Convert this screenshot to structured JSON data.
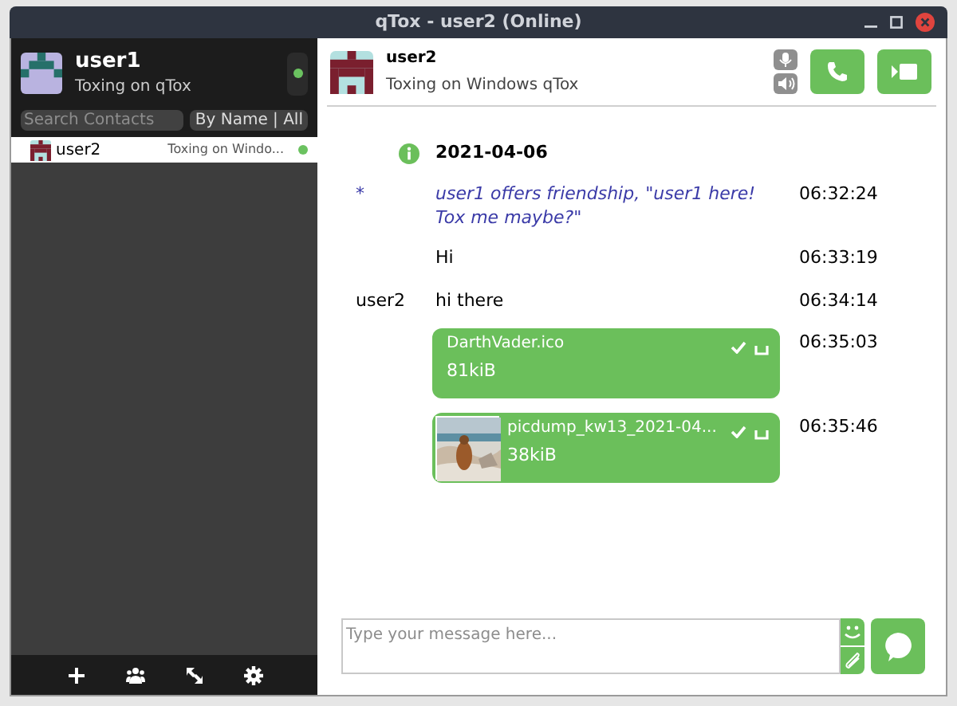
{
  "window": {
    "title": "qTox - user2 (Online)"
  },
  "profile": {
    "name": "user1",
    "status_message": "Toxing on qTox",
    "online": true
  },
  "search": {
    "placeholder": "Search Contacts"
  },
  "filter_button": "By Name | All",
  "contacts": [
    {
      "name": "user2",
      "status_message": "Toxing on Windo...",
      "online": true,
      "selected": true
    }
  ],
  "chat_header": {
    "name": "user2",
    "status_message": "Toxing on Windows qTox"
  },
  "messages": [
    {
      "kind": "date",
      "text": "2021-04-06"
    },
    {
      "kind": "action",
      "author": "*",
      "text": "user1 offers friendship, \"user1 here! Tox me maybe?\"",
      "time": "06:32:24"
    },
    {
      "kind": "text",
      "text": "Hi",
      "time": "06:33:19"
    },
    {
      "kind": "text",
      "author": "user2",
      "text": "hi there",
      "time": "06:34:14"
    },
    {
      "kind": "file",
      "file_name": "DarthVader.ico",
      "size": "81kiB",
      "time": "06:35:03",
      "preview": false
    },
    {
      "kind": "file",
      "file_name": "picdump_kw13_2021-04...",
      "size": "38kiB",
      "time": "06:35:46",
      "preview": true
    }
  ],
  "composer": {
    "placeholder": "Type your message here..."
  }
}
